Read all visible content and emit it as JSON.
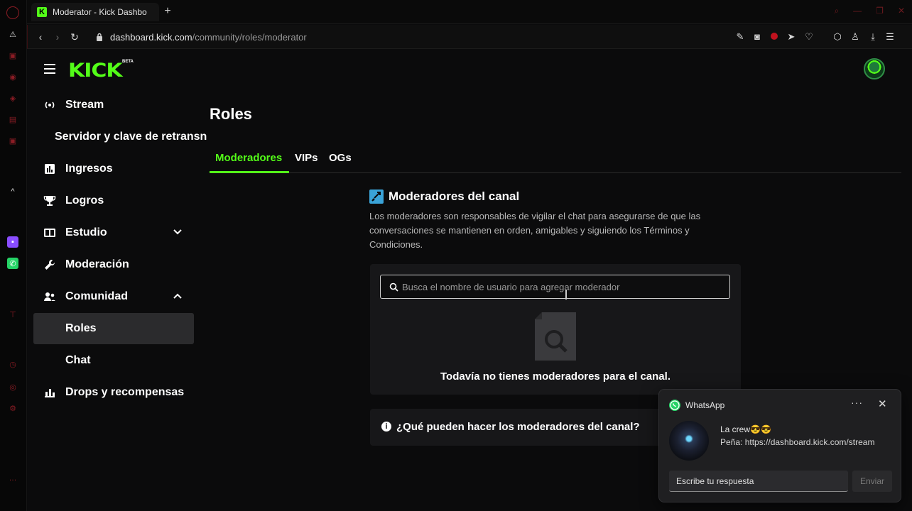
{
  "browser": {
    "tab_title": "Moderator - Kick Dashbo",
    "new_tab_label": "+",
    "url_prefix": "",
    "url_domain": "dashboard.kick.com",
    "url_path": "/community/roles/moderator"
  },
  "header": {
    "logo_text": "KICK",
    "logo_badge": "BETA"
  },
  "sidebar": {
    "items": [
      {
        "label": "Stream",
        "icon": "broadcast-icon"
      },
      {
        "label": "Servidor y clave de retransn",
        "icon": ""
      },
      {
        "label": "Ingresos",
        "icon": "bar-chart-icon"
      },
      {
        "label": "Logros",
        "icon": "trophy-icon"
      },
      {
        "label": "Estudio",
        "icon": "studio-icon"
      },
      {
        "label": "Moderación",
        "icon": "wrench-icon"
      },
      {
        "label": "Comunidad",
        "icon": "users-icon"
      },
      {
        "label": "Roles",
        "icon": ""
      },
      {
        "label": "Chat",
        "icon": ""
      },
      {
        "label": "Drops y recompensas",
        "icon": "gift-chart-icon"
      }
    ]
  },
  "main": {
    "title": "Roles",
    "tabs": [
      {
        "label": "Moderadores"
      },
      {
        "label": "VIPs"
      },
      {
        "label": "OGs"
      }
    ],
    "section_title": "Moderadores del canal",
    "section_desc": "Los moderadores son responsables de vigilar el chat para asegurarse de que las conversaciones se mantienen en orden, amigables y siguiendo los Términos y Condiciones.",
    "search_placeholder": "Busca el nombre de usuario para agregar moderador",
    "empty_text": "Todavía no tienes moderadores para el canal.",
    "faq_text": "¿Qué pueden hacer los moderadores del canal?"
  },
  "whatsapp": {
    "app_name": "WhatsApp",
    "more": "···",
    "close": "✕",
    "sender": "La crew😎😎",
    "message": "Peña: https://dashboard.kick.com/stream",
    "reply_placeholder": "Escribe tu respuesta",
    "send_label": "Enviar"
  },
  "colors": {
    "accent": "#53fc18",
    "background": "#0b0b0c",
    "card": "#171719",
    "active_nav": "#2b2b2d"
  }
}
